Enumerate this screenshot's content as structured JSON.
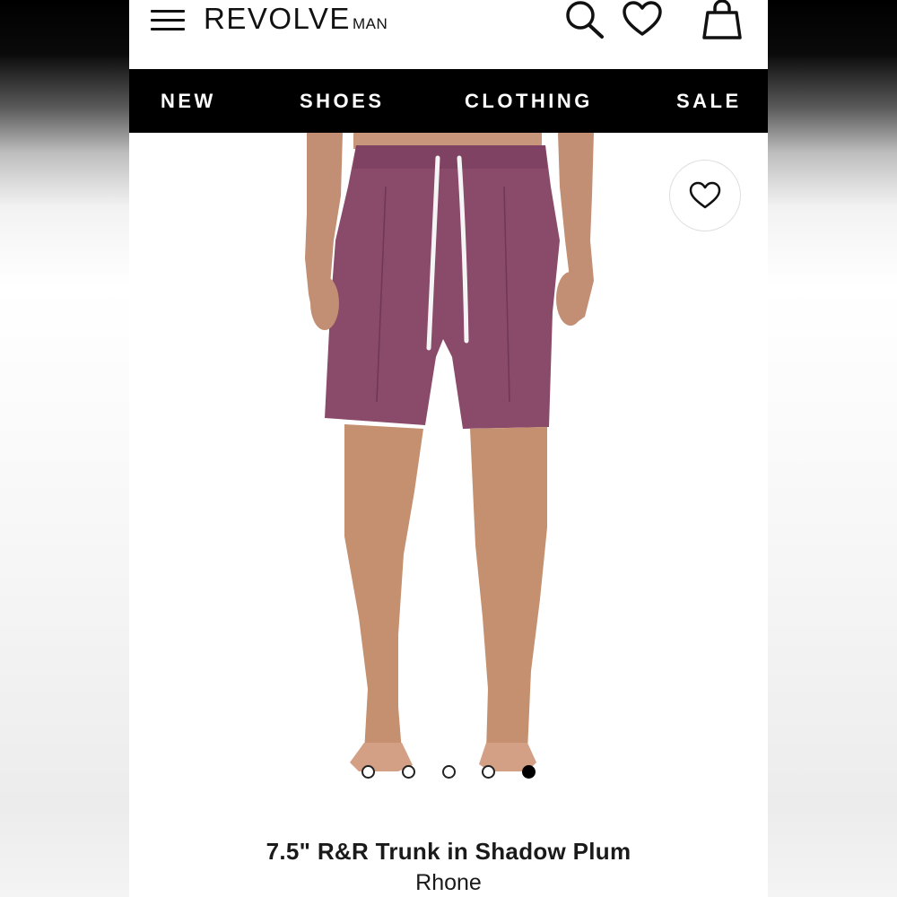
{
  "header": {
    "logo_main": "REVOLVE",
    "logo_sub": "MAN",
    "menu_icon": "hamburger-menu-icon",
    "search_icon": "search-icon",
    "wishlist_icon": "heart-icon",
    "bag_icon": "shopping-bag-icon"
  },
  "nav": {
    "items": [
      {
        "label": "NEW"
      },
      {
        "label": "SHOES"
      },
      {
        "label": "CLOTHING"
      },
      {
        "label": "SALE"
      }
    ]
  },
  "gallery": {
    "favorite_icon": "heart-outline-icon",
    "dot_count": 5,
    "active_index": 4
  },
  "product": {
    "title": "7.5\" R&R Trunk in Shadow Plum",
    "brand": "Rhone"
  },
  "colors": {
    "nav_background": "#000000",
    "shorts": "#8a4a6a",
    "skin": "#c89478"
  }
}
